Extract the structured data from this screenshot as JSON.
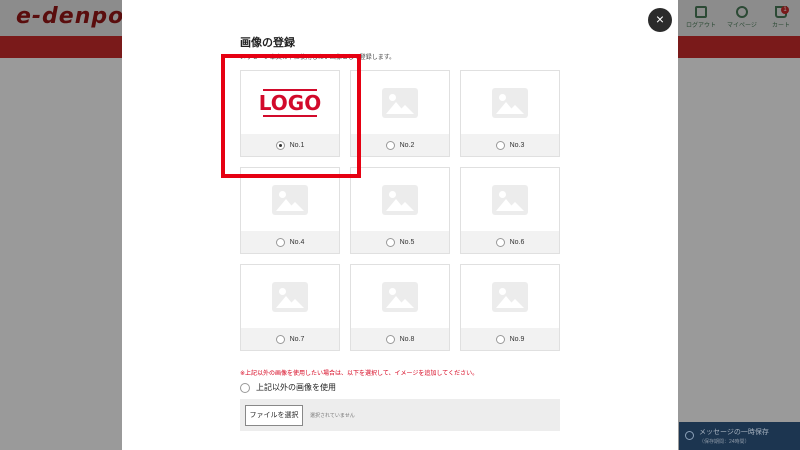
{
  "site": {
    "logo_text": "e-denpo",
    "nav": [
      {
        "label": "ログアウト",
        "icon": "lock-icon"
      },
      {
        "label": "マイページ",
        "icon": "user-icon"
      },
      {
        "label": "カート",
        "icon": "cart-icon",
        "badge": "1"
      }
    ],
    "save_message": {
      "label": "メッセージの一時保存",
      "sub": "（保存期間：24時間）"
    }
  },
  "modal": {
    "title": "画像の登録",
    "description": "メッセージ本文の下に使用したい画像として登録します。",
    "close_label": "×",
    "images": [
      {
        "label": "No.1",
        "type": "logo",
        "logo_text": "LOGO",
        "selected": true
      },
      {
        "label": "No.2",
        "type": "placeholder",
        "selected": false
      },
      {
        "label": "No.3",
        "type": "placeholder",
        "selected": false
      },
      {
        "label": "No.4",
        "type": "placeholder",
        "selected": false
      },
      {
        "label": "No.5",
        "type": "placeholder",
        "selected": false
      },
      {
        "label": "No.6",
        "type": "placeholder",
        "selected": false
      },
      {
        "label": "No.7",
        "type": "placeholder",
        "selected": false
      },
      {
        "label": "No.8",
        "type": "placeholder",
        "selected": false
      },
      {
        "label": "No.9",
        "type": "placeholder",
        "selected": false
      }
    ],
    "note": "※上記以外の画像を使用したい場合は、以下を選択して、イメージを追加してください。",
    "other_option_label": "上記以外の画像を使用",
    "file_button_label": "ファイルを選択",
    "file_status": "選択されていません"
  },
  "colors": {
    "accent": "#d20a2b",
    "highlight": "#e60012",
    "overlay": "#808080"
  }
}
